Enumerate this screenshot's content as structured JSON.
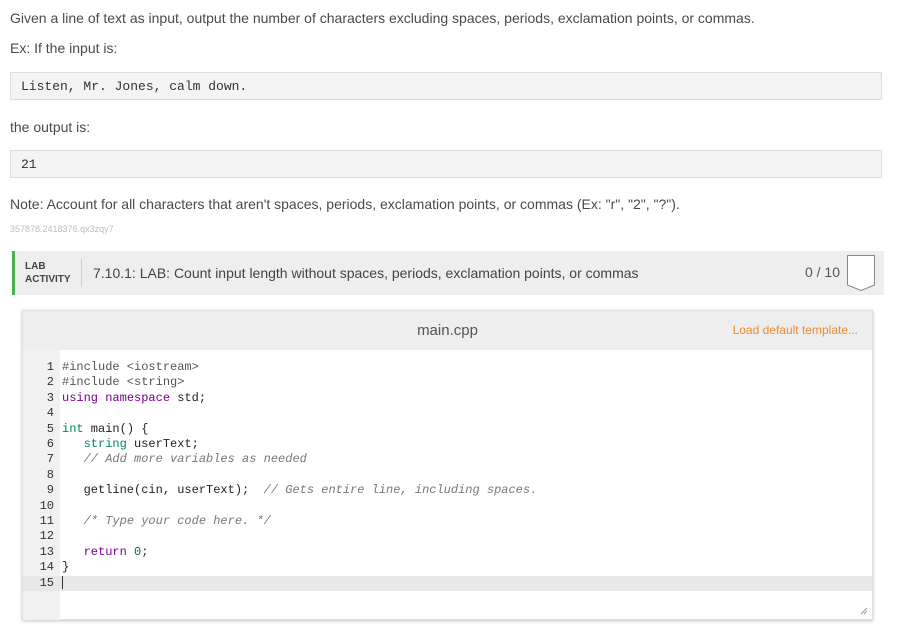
{
  "instructions": {
    "line1": "Given a line of text as input, output the number of characters excluding spaces, periods, exclamation points, or commas.",
    "line2": "Ex: If the input is:",
    "example_input": "Listen, Mr. Jones, calm down.",
    "line3": "the output is:",
    "example_output": "21",
    "note": "Note: Account for all characters that aren't spaces, periods, exclamation points, or commas (Ex: \"r\", \"2\", \"?\").",
    "id": "357878.2418376.qx3zqy7"
  },
  "lab": {
    "label_line1": "LAB",
    "label_line2": "ACTIVITY",
    "title": "7.10.1: LAB: Count input length without spaces, periods, exclamation points, or commas",
    "score": "0 / 10",
    "accent_color": "#4caf50"
  },
  "editor": {
    "filename": "main.cpp",
    "load_template_label": "Load default template...",
    "code_lines": [
      "#include <iostream>",
      "#include <string>",
      "using namespace std;",
      "",
      "int main() {",
      "   string userText;",
      "   // Add more variables as needed",
      "",
      "   getline(cin, userText);  // Gets entire line, including spaces.",
      "",
      "   /* Type your code here. */",
      "",
      "   return 0;",
      "}",
      ""
    ],
    "line_numbers": [
      "1",
      "2",
      "3",
      "4",
      "5",
      "6",
      "7",
      "8",
      "9",
      "10",
      "11",
      "12",
      "13",
      "14",
      "15"
    ]
  }
}
